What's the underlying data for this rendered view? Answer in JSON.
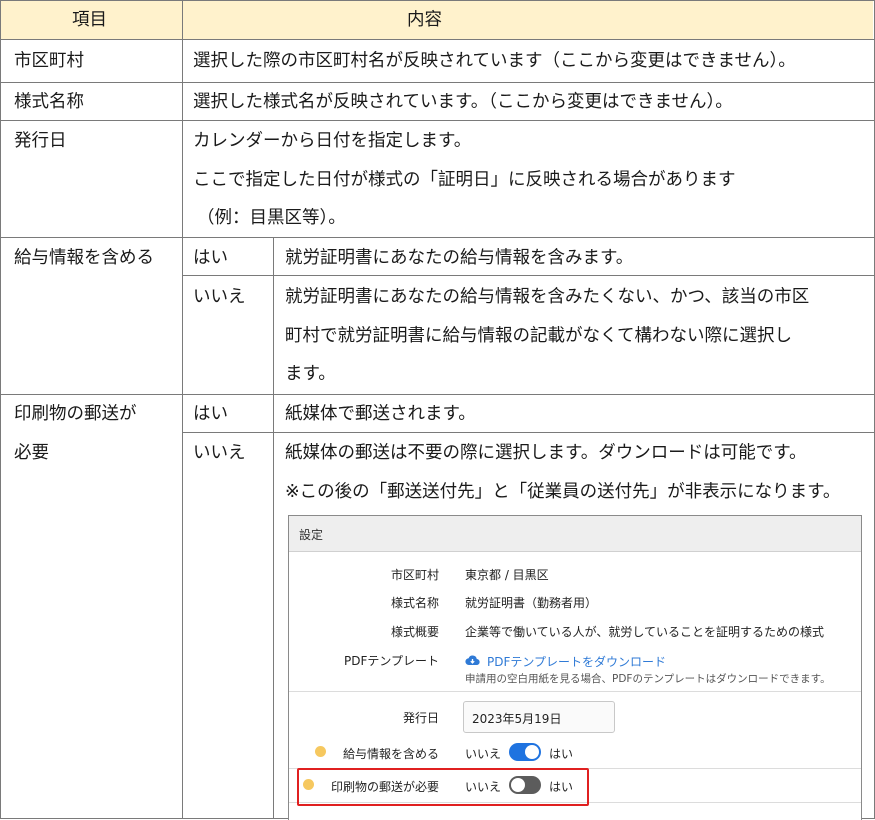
{
  "header": {
    "col_item": "項目",
    "col_content": "内容"
  },
  "rows": {
    "municipality": {
      "item": "市区町村",
      "content": "選択した際の市区町村名が反映されています（ここから変更はできません）。"
    },
    "form_name": {
      "item": "様式名称",
      "content": "選択した様式名が反映されています。（ここから変更はできません）。"
    },
    "issue_date": {
      "item": "発行日",
      "line1": "カレンダーから日付を指定します。",
      "line2": "ここで指定した日付が様式の「証明日」に反映される場合があります",
      "line3": "（例：目黒区等）。"
    },
    "salary": {
      "item": "給与情報を含める",
      "yes": {
        "label": "はい",
        "content": "就労証明書にあなたの給与情報を含みます。"
      },
      "no": {
        "label": "いいえ",
        "line1": "就労証明書にあなたの給与情報を含みたくない、かつ、該当の市区",
        "line2": "町村で就労証明書に給与情報の記載がなくて構わない際に選択し",
        "line3": "ます。"
      }
    },
    "mail": {
      "item_line1": "印刷物の郵送が",
      "item_line2": "必要",
      "yes": {
        "label": "はい",
        "content": "紙媒体で郵送されます。"
      },
      "no": {
        "label": "いいえ",
        "line1": "紙媒体の郵送は不要の際に選択します。ダウンロードは可能です。",
        "line2": "※この後の「郵送送付先」と「従業員の送付先」が非表示になります。"
      }
    }
  },
  "screenshot": {
    "title": "設定",
    "fields": {
      "municipality": {
        "label": "市区町村",
        "value": "東京都 / 目黒区"
      },
      "form_name": {
        "label": "様式名称",
        "value": "就労証明書（勤務者用）"
      },
      "overview": {
        "label": "様式概要",
        "value": "企業等で働いている人が、就労していることを証明するための様式"
      },
      "pdf": {
        "label": "PDFテンプレート",
        "link": "PDFテンプレートをダウンロード",
        "hint": "申請用の空白用紙を見る場合、PDFのテンプレートはダウンロードできます。"
      },
      "issue_date": {
        "label": "発行日",
        "value": "2023年5月19日"
      },
      "salary": {
        "label": "給与情報を含める",
        "no": "いいえ",
        "yes": "はい",
        "state": true
      },
      "mail": {
        "label": "印刷物の郵送が必要",
        "no": "いいえ",
        "yes": "はい",
        "state": false
      }
    },
    "colors": {
      "toggle_on": "#1f73e0",
      "toggle_off": "#5c5c5c",
      "highlight": "#e02020",
      "link": "#2f7ad6"
    }
  }
}
